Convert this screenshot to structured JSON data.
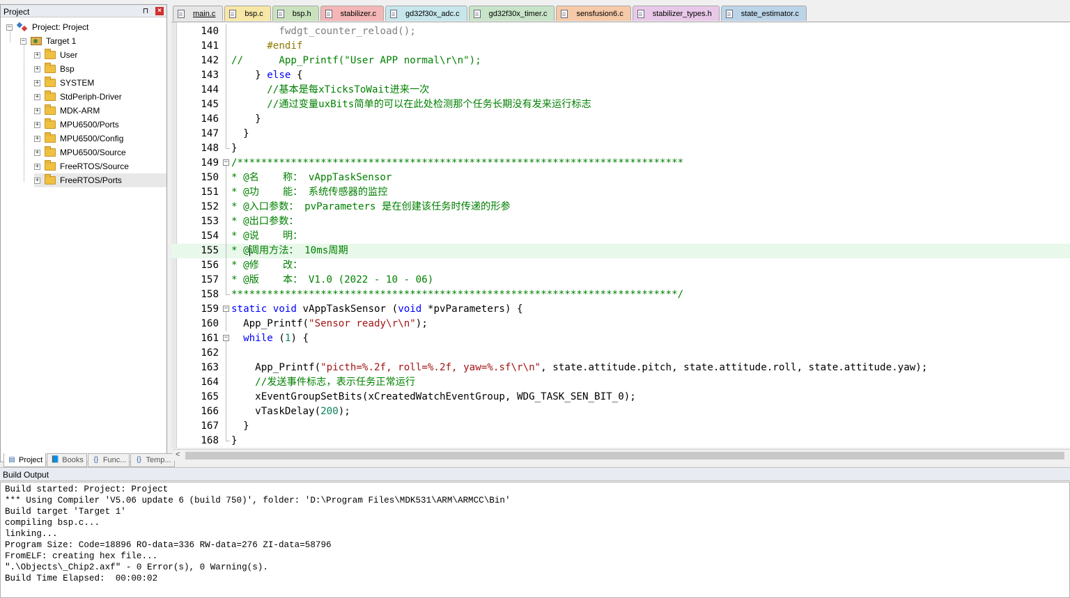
{
  "project_panel": {
    "title": "Project",
    "pin_glyph": "⊓",
    "close_glyph": "×",
    "tree": {
      "root": "Project: Project",
      "target": "Target 1",
      "groups": [
        "User",
        "Bsp",
        "SYSTEM",
        "StdPeriph-Driver",
        "MDK-ARM",
        "MPU6500/Ports",
        "MPU6500/Config",
        "MPU6500/Source",
        "FreeRTOS/Source",
        "FreeRTOS/Ports"
      ],
      "selected": "FreeRTOS/Ports"
    },
    "bottom_tabs": [
      {
        "label": "Project",
        "icon": "project-window-icon",
        "active": true
      },
      {
        "label": "Books",
        "icon": "books-icon",
        "active": false
      },
      {
        "label": "Func...",
        "icon": "functions-icon",
        "active": false
      },
      {
        "label": "Temp...",
        "icon": "templates-icon",
        "active": false
      }
    ]
  },
  "editor_tabs": [
    {
      "label": "main.c",
      "color": "#e6e6e6",
      "active": true
    },
    {
      "label": "bsp.c",
      "color": "#f7e7a6",
      "active": false
    },
    {
      "label": "bsp.h",
      "color": "#c9e2bd",
      "active": false
    },
    {
      "label": "stabilizer.c",
      "color": "#f4b6b6",
      "active": false
    },
    {
      "label": "gd32f30x_adc.c",
      "color": "#c6e6ec",
      "active": false
    },
    {
      "label": "gd32f30x_timer.c",
      "color": "#c8e4c8",
      "active": false
    },
    {
      "label": "sensfusion6.c",
      "color": "#f6c9a8",
      "active": false
    },
    {
      "label": "stabilizer_types.h",
      "color": "#e8c8e8",
      "active": false
    },
    {
      "label": "state_estimator.c",
      "color": "#bcd4e8",
      "active": false
    }
  ],
  "code": {
    "lines": [
      {
        "n": "140",
        "fold": "line",
        "tokens": [
          [
            "dim",
            "        fwdgt_counter_reload();"
          ]
        ]
      },
      {
        "n": "141",
        "fold": "line",
        "tokens": [
          [
            "pp",
            "      #endif"
          ]
        ]
      },
      {
        "n": "142",
        "fold": "line",
        "tokens": [
          [
            "cm",
            "//      App_Printf(\"User APP normal\\r\\n\");"
          ]
        ]
      },
      {
        "n": "143",
        "fold": "line",
        "tokens": [
          [
            "fn",
            "    } "
          ],
          [
            "kw",
            "else"
          ],
          [
            "fn",
            " {"
          ]
        ]
      },
      {
        "n": "144",
        "fold": "line",
        "tokens": [
          [
            "cm",
            "      //基本是每xTicksToWait进来一次"
          ]
        ]
      },
      {
        "n": "145",
        "fold": "line",
        "tokens": [
          [
            "cm",
            "      //通过变量uxBits简单的可以在此处检测那个任务长期没有发来运行标志"
          ]
        ]
      },
      {
        "n": "146",
        "fold": "line",
        "tokens": [
          [
            "fn",
            "    }"
          ]
        ]
      },
      {
        "n": "147",
        "fold": "line",
        "tokens": [
          [
            "fn",
            "  }"
          ]
        ]
      },
      {
        "n": "148",
        "fold": "end",
        "tokens": [
          [
            "fn",
            "}"
          ]
        ]
      },
      {
        "n": "149",
        "fold": "box",
        "tokens": [
          [
            "cm",
            "/***************************************************************************"
          ]
        ]
      },
      {
        "n": "150",
        "fold": "line",
        "tokens": [
          [
            "cm",
            "* @名    称： vAppTaskSensor"
          ]
        ]
      },
      {
        "n": "151",
        "fold": "line",
        "tokens": [
          [
            "cm",
            "* @功    能： 系统传感器的监控"
          ]
        ]
      },
      {
        "n": "152",
        "fold": "line",
        "tokens": [
          [
            "cm",
            "* @入口参数： pvParameters 是在创建该任务时传递的形参"
          ]
        ]
      },
      {
        "n": "153",
        "fold": "line",
        "tokens": [
          [
            "cm",
            "* @出口参数："
          ]
        ]
      },
      {
        "n": "154",
        "fold": "line",
        "tokens": [
          [
            "cm",
            "* @说    明："
          ]
        ]
      },
      {
        "n": "155",
        "fold": "line",
        "tokens": [
          [
            "cm",
            "* @"
          ],
          [
            "caret",
            ""
          ],
          [
            "cm",
            "调用方法： 10ms周期"
          ]
        ],
        "highlight": true
      },
      {
        "n": "156",
        "fold": "line",
        "tokens": [
          [
            "cm",
            "* @修    改："
          ]
        ]
      },
      {
        "n": "157",
        "fold": "line",
        "tokens": [
          [
            "cm",
            "* @版    本： V1.0 (2022 - 10 - 06)"
          ]
        ]
      },
      {
        "n": "158",
        "fold": "end",
        "tokens": [
          [
            "cm",
            "***************************************************************************/"
          ]
        ]
      },
      {
        "n": "159",
        "fold": "box",
        "tokens": [
          [
            "kw",
            "static"
          ],
          [
            "fn",
            " "
          ],
          [
            "kw",
            "void"
          ],
          [
            "fn",
            " vAppTaskSensor ("
          ],
          [
            "kw",
            "void"
          ],
          [
            "fn",
            " *pvParameters) {"
          ]
        ]
      },
      {
        "n": "160",
        "fold": "line",
        "tokens": [
          [
            "fn",
            "  App_Printf("
          ],
          [
            "str",
            "\"Sensor ready\\r\\n\""
          ],
          [
            "fn",
            ");"
          ]
        ]
      },
      {
        "n": "161",
        "fold": "box",
        "tokens": [
          [
            "fn",
            "  "
          ],
          [
            "kw",
            "while"
          ],
          [
            "fn",
            " ("
          ],
          [
            "num",
            "1"
          ],
          [
            "fn",
            ") {"
          ]
        ]
      },
      {
        "n": "162",
        "fold": "line",
        "tokens": [
          [
            "fn",
            ""
          ]
        ]
      },
      {
        "n": "163",
        "fold": "line",
        "tokens": [
          [
            "fn",
            "    App_Printf("
          ],
          [
            "str",
            "\"picth=%.2f, roll=%.2f, yaw=%.sf\\r\\n\""
          ],
          [
            "fn",
            ", state.attitude.pitch, state.attitude.roll, state.attitude.yaw);"
          ]
        ]
      },
      {
        "n": "164",
        "fold": "line",
        "tokens": [
          [
            "cm",
            "    //发送事件标志，表示任务正常运行"
          ]
        ]
      },
      {
        "n": "165",
        "fold": "line",
        "tokens": [
          [
            "fn",
            "    xEventGroupSetBits(xCreatedWatchEventGroup, WDG_TASK_SEN_BIT_0);"
          ]
        ]
      },
      {
        "n": "166",
        "fold": "line",
        "tokens": [
          [
            "fn",
            "    vTaskDelay("
          ],
          [
            "num",
            "200"
          ],
          [
            "fn",
            ");"
          ]
        ]
      },
      {
        "n": "167",
        "fold": "line",
        "tokens": [
          [
            "fn",
            "  }"
          ]
        ]
      },
      {
        "n": "168",
        "fold": "end",
        "tokens": [
          [
            "fn",
            "}"
          ]
        ]
      }
    ]
  },
  "scrollbar": {
    "left_arrow": "<"
  },
  "build_output": {
    "title": "Build Output",
    "lines": [
      "Build started: Project: Project",
      "*** Using Compiler 'V5.06 update 6 (build 750)', folder: 'D:\\Program Files\\MDK531\\ARM\\ARMCC\\Bin'",
      "Build target 'Target 1'",
      "compiling bsp.c...",
      "linking...",
      "Program Size: Code=18896 RO-data=336 RW-data=276 ZI-data=58796",
      "FromELF: creating hex file...",
      "\".\\Objects\\_Chip2.axf\" - 0 Error(s), 0 Warning(s).",
      "Build Time Elapsed:  00:00:02"
    ]
  }
}
